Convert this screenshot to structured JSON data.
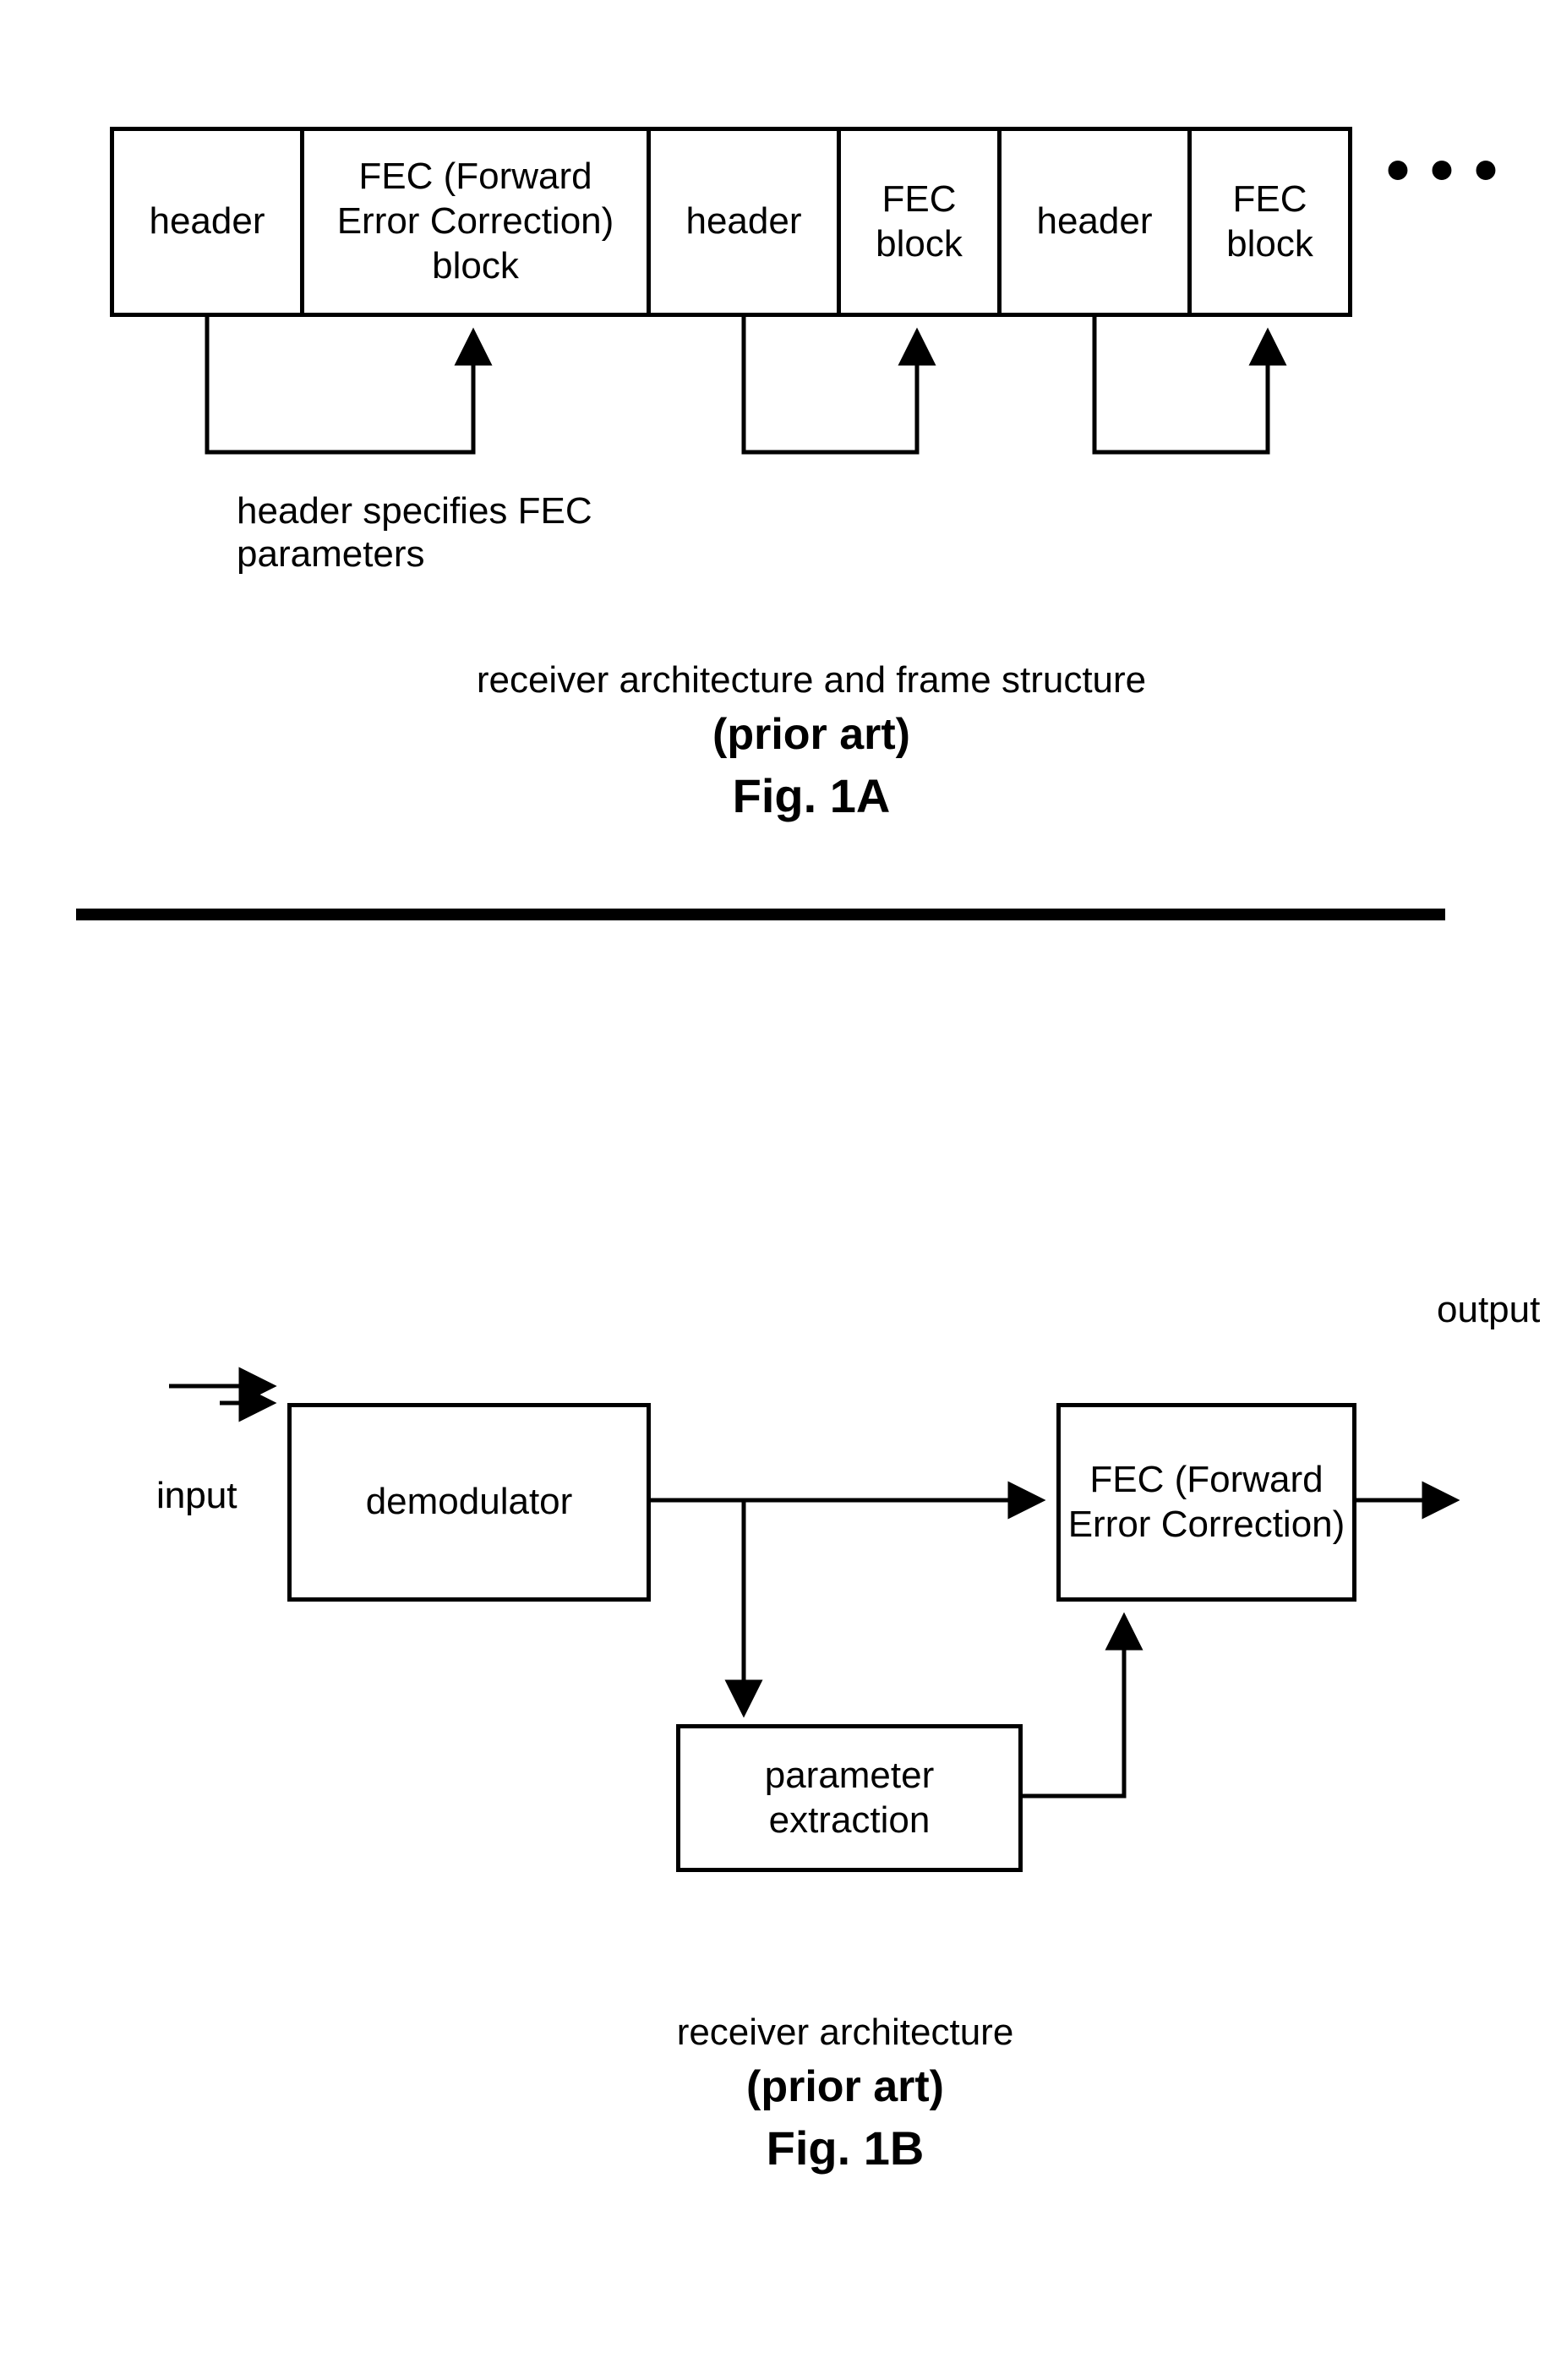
{
  "figA": {
    "frame": {
      "cells": [
        {
          "label": "header"
        },
        {
          "label": "FEC (Forward\nError Correction)\nblock"
        },
        {
          "label": "header"
        },
        {
          "label": "FEC\nblock"
        },
        {
          "label": "header"
        },
        {
          "label": "FEC\nblock"
        }
      ]
    },
    "annotation": "header specifies FEC\nparameters",
    "caption_line1": "receiver architecture and frame structure",
    "caption_line2": "(prior art)",
    "caption_line3": "Fig. 1A"
  },
  "figB": {
    "input_label": "input",
    "output_label": "output",
    "blocks": {
      "demodulator": "demodulator",
      "param_extraction": "parameter\nextraction",
      "fec": "FEC (Forward\nError Correction)"
    },
    "caption_line1": "receiver architecture",
    "caption_line2": "(prior art)",
    "caption_line3": "Fig. 1B"
  }
}
